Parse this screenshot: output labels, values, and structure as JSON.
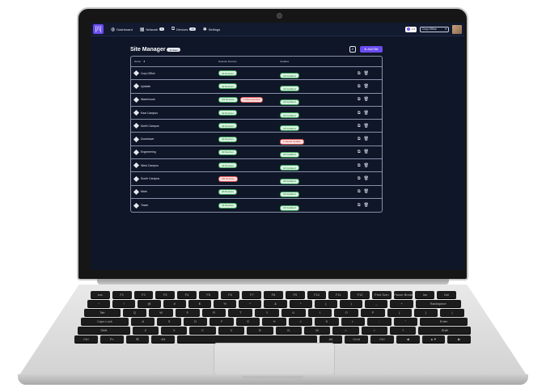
{
  "nav": {
    "logo": "[/\\]",
    "items": [
      {
        "label": "Dashboard",
        "icon": "dashboard-icon",
        "glyph": "◍"
      },
      {
        "label": "Network",
        "icon": "network-icon",
        "glyph": "▦",
        "badge": "6"
      },
      {
        "label": "Devices",
        "icon": "devices-icon",
        "glyph": "⧉",
        "badge": "14"
      },
      {
        "label": "Settings",
        "icon": "gear-icon",
        "glyph": "✱"
      }
    ],
    "status_count": "1/4",
    "site_selected": "Corp Office"
  },
  "page": {
    "title": "Site Manager",
    "count": "11 Sites",
    "add_label": "Add Site"
  },
  "table": {
    "headers": [
      "Name",
      "Network Devices",
      "Updates"
    ],
    "rows": [
      {
        "name": "Corp Office",
        "devices": "All Devices",
        "devices_status": "ok",
        "alert": "",
        "updates": "All Updated",
        "updates_status": "ok"
      },
      {
        "name": "Upstate",
        "devices": "All Devices",
        "devices_status": "ok",
        "alert": "",
        "updates": "All Updated",
        "updates_status": "ok"
      },
      {
        "name": "Warehouse",
        "devices": "3/4 Devices",
        "devices_status": "ok",
        "alert": "1 Disconnected",
        "updates": "All Updated",
        "updates_status": "ok"
      },
      {
        "name": "East Campus",
        "devices": "All Devices",
        "devices_status": "ok",
        "alert": "",
        "updates": "All Updated",
        "updates_status": "ok"
      },
      {
        "name": "North Campus",
        "devices": "All Devices",
        "devices_status": "ok",
        "alert": "",
        "updates": "All Updated",
        "updates_status": "ok"
      },
      {
        "name": "Downtown",
        "devices": "All Devices",
        "devices_status": "ok",
        "alert": "",
        "updates": "1 Needs Update",
        "updates_status": "bad"
      },
      {
        "name": "Engineering",
        "devices": "All Devices",
        "devices_status": "ok",
        "alert": "",
        "updates": "All Updated",
        "updates_status": "ok"
      },
      {
        "name": "West Campus",
        "devices": "All Devices",
        "devices_status": "ok",
        "alert": "",
        "updates": "All Updated",
        "updates_status": "ok"
      },
      {
        "name": "South Campus",
        "devices": "0/5 Devices",
        "devices_status": "bad",
        "alert": "",
        "updates": "All Updated",
        "updates_status": "ok"
      },
      {
        "name": "Mark",
        "devices": "All Devices",
        "devices_status": "ok",
        "alert": "",
        "updates": "All Updated",
        "updates_status": "ok"
      },
      {
        "name": "Tower",
        "devices": "All Devices",
        "devices_status": "ok",
        "alert": "",
        "updates": "All Updated",
        "updates_status": "ok"
      }
    ]
  },
  "keyboard": {
    "rows": [
      [
        "esc",
        "F1",
        "F2",
        "F3",
        "F4",
        "F5",
        "F6",
        "F7",
        "F8",
        "F9",
        "F10",
        "F11",
        "F12",
        "Print Scrn",
        "Pause Break",
        "Ins",
        "Del"
      ],
      [
        "~",
        "!",
        "@",
        "#",
        "$",
        "%",
        "^",
        "&",
        "*",
        "(",
        ")",
        "_",
        "+",
        "Backspace"
      ],
      [
        "Tab",
        "Q",
        "W",
        "E",
        "R",
        "T",
        "Y",
        "U",
        "I",
        "O",
        "P",
        "{",
        "}",
        "|"
      ],
      [
        "Caps Lock",
        "A",
        "S",
        "D",
        "F",
        "G",
        "H",
        "J",
        "K",
        "L",
        ":",
        "\"",
        "Enter"
      ],
      [
        "Shift",
        "Z",
        "X",
        "C",
        "V",
        "B",
        "N",
        "M",
        "<",
        ">",
        "?",
        "Shift"
      ],
      [
        "Ctrl",
        "Fn",
        "⊞",
        "Alt",
        "",
        "Alt",
        "Cmd",
        "Ctrl",
        "◀",
        "▲▼",
        "▶"
      ]
    ]
  },
  "colors": {
    "accent": "#6a4cf0",
    "screen_bg": "#0f1628",
    "ok": "#3fa35a",
    "bad": "#e05a5a"
  }
}
